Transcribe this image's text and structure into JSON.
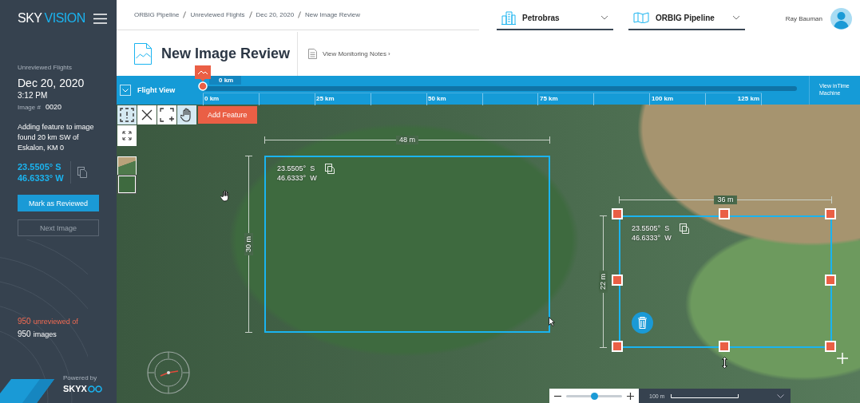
{
  "sidebar": {
    "logo_primary": "SKY",
    "logo_secondary": "VISION",
    "section_label": "Unreviewed Flights",
    "date": "Dec 20, 2020",
    "time": "3:12 PM",
    "image_label": "Image #",
    "image_number": "0020",
    "description": "Adding feature to image found 20 km SW of Eskalon, KM 0",
    "coordinates": [
      "23.5505° S",
      "46.6333° W"
    ],
    "buttons": [
      {
        "label": "Mark as Reviewed",
        "kind": "primary",
        "disabled": false
      },
      {
        "label": "Next Image",
        "kind": "secondary",
        "disabled": true
      }
    ],
    "unreviewed_count": "950",
    "unreviewed_label": "unreviewed of",
    "total_count": "950",
    "total_label": "images",
    "powered_by": "Powered by",
    "brand": "SKYX"
  },
  "header": {
    "breadcrumb": [
      "ORBIG Pipeline",
      "Unreviewed Flights",
      "Dec 20, 2020",
      "New Image Review"
    ],
    "selectors": [
      {
        "label": "Petrobras"
      },
      {
        "label": "ORBIG Pipeline"
      }
    ],
    "user": "Ray Bauman",
    "title": "New Image Review",
    "notes_link": "View Monitoring Notes ›"
  },
  "timeline": {
    "toggle_label": "Flight View",
    "position_label": "0 km",
    "level": 0,
    "ticks": [
      "0 km",
      "25 km",
      "50 km",
      "75 km",
      "100 km",
      "125 km"
    ],
    "time_machine": "View inTime Machine"
  },
  "map": {
    "tools": [
      {
        "selected": true
      },
      {
        "selected": false
      },
      {
        "selected": false
      },
      {
        "selected": true
      }
    ],
    "add_button": "Add Feature",
    "thumbnails": [
      {
        "selected": false
      },
      {
        "selected": true
      }
    ],
    "features": [
      {
        "width_label": "48 m",
        "height_label": "30 m",
        "coordinates": [
          "23.5505°  S",
          "46.6333°  W"
        ],
        "selected": false
      },
      {
        "width_label": "36 m",
        "height_label": "22 m",
        "coordinates": [
          "23.5505°  S",
          "46.6333°  W"
        ],
        "selected": true
      }
    ],
    "zoom": {
      "level": 0.5
    },
    "scale": "100 m"
  }
}
